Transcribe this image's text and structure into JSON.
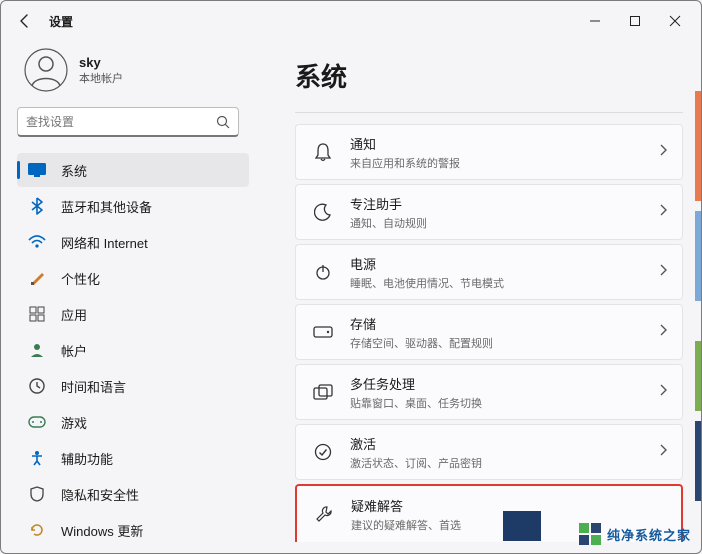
{
  "window": {
    "title": "设置"
  },
  "account": {
    "name": "sky",
    "type": "本地帐户"
  },
  "search": {
    "placeholder": "查找设置"
  },
  "sidebar": {
    "items": [
      {
        "label": "系统",
        "key": "system"
      },
      {
        "label": "蓝牙和其他设备",
        "key": "bluetooth"
      },
      {
        "label": "网络和 Internet",
        "key": "network"
      },
      {
        "label": "个性化",
        "key": "personalization"
      },
      {
        "label": "应用",
        "key": "apps"
      },
      {
        "label": "帐户",
        "key": "accounts"
      },
      {
        "label": "时间和语言",
        "key": "time-language"
      },
      {
        "label": "游戏",
        "key": "gaming"
      },
      {
        "label": "辅助功能",
        "key": "accessibility"
      },
      {
        "label": "隐私和安全性",
        "key": "privacy"
      },
      {
        "label": "Windows 更新",
        "key": "update"
      }
    ],
    "active_index": 0
  },
  "page": {
    "title": "系统"
  },
  "settings": [
    {
      "title": "通知",
      "sub": "来自应用和系统的警报",
      "icon": "bell"
    },
    {
      "title": "专注助手",
      "sub": "通知、自动规则",
      "icon": "moon"
    },
    {
      "title": "电源",
      "sub": "睡眠、电池使用情况、节电模式",
      "icon": "power"
    },
    {
      "title": "存储",
      "sub": "存储空间、驱动器、配置规则",
      "icon": "storage"
    },
    {
      "title": "多任务处理",
      "sub": "贴靠窗口、桌面、任务切换",
      "icon": "multitask"
    },
    {
      "title": "激活",
      "sub": "激活状态、订阅、产品密钥",
      "icon": "activation"
    },
    {
      "title": "疑难解答",
      "sub": "建议的疑难解答、首选",
      "icon": "troubleshoot",
      "highlight": true
    }
  ],
  "watermark": {
    "text": "纯净系统之家",
    "url_fragment": "YCWIN.COM"
  }
}
